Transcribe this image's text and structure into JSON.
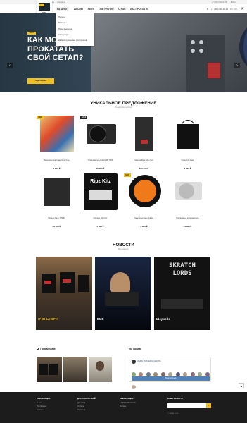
{
  "topbar": {
    "left": [
      "Оплата",
      "Доставка",
      "Контакты"
    ],
    "right": [
      "+7 (000) 000-00-00",
      "Войти"
    ]
  },
  "header": {
    "logo_text": "KAI",
    "nav": [
      "КАТАЛОГ",
      "ШКОЛЫ",
      "RENT",
      "ПОРТФОЛИО",
      "О НАС",
      "КАК ПРОЕХАТЬ"
    ],
    "search_icon": "search-icon",
    "phone": "+7 (000) 000-00-00",
    "langs": "RU / EN",
    "cart_icon": "cart-icon"
  },
  "dropdown": {
    "items": [
      "Пульты",
      "Миксеры",
      "Проигрыватели",
      "Аксессуары",
      "Кабели и разъёмы для пультов"
    ]
  },
  "hero": {
    "badge": "RENT",
    "title": "КАК МОЖНО ПРОКАТАТЬ СВОЙ СЕТАП?",
    "button": "ПОДРОБНЕЕ",
    "prev": "‹",
    "next": "›"
  },
  "products_section": {
    "title": "УНИКАЛЬНОЕ ПРЕДЛОЖЕНИЕ",
    "subtitle": "Посмотреть каталог",
    "items": [
      {
        "name": "Виниловая пластинка Ninja Tune",
        "price": "3 800 ₽",
        "badge": "NEW"
      },
      {
        "name": "Проигрыватель Reloop RP-7000",
        "price": "42 000 ₽",
        "badge": "SALE"
      },
      {
        "name": "Микшер Rane Sixty-Two",
        "price": "120 000 ₽",
        "badge": ""
      },
      {
        "name": "Сумка KAI black",
        "price": "1 990 ₽",
        "badge": ""
      },
      {
        "name": "Микшер Rane TTM 57",
        "price": "38 000 ₽",
        "badge": ""
      },
      {
        "name": "Слипмат Ripz Kitz",
        "price": "1 500 ₽",
        "badge": ""
      },
      {
        "name": "Часы виниловые Orange",
        "price": "3 800 ₽",
        "badge": "NEW"
      },
      {
        "name": "Портативный проигрыватель",
        "price": "14 490 ₽",
        "badge": ""
      }
    ]
  },
  "news_section": {
    "title": "НОВОСТИ",
    "subtitle": "Все новости",
    "items": [
      "ОЧЕНЬ НЕРЧ",
      "DMC",
      "Шоу кейс"
    ]
  },
  "social": {
    "instagram_title": "/ onkaimaster",
    "vk_title": "/ onkai",
    "vk_group": "ONKAI MASTER DJ ШКОЛА",
    "vk_button": "Подписаться"
  },
  "footer": {
    "col1": {
      "title": "ИНФОРМАЦИЯ",
      "items": [
        "О нас",
        "Портфолио",
        "Контакты"
      ]
    },
    "col2": {
      "title": "ДЛЯ ПОКУПАТЕЛЕЙ",
      "items": [
        "Доставка",
        "Оплата",
        "Гарантия"
      ]
    },
    "col3": {
      "title": "ИНФОРМАЦИЯ",
      "items": [
        "+7 (000) 000-00-00",
        "Москва"
      ]
    },
    "col4": {
      "title": "НАШИ НОВОСТИ"
    },
    "copy": "© ONKAI, 2019"
  },
  "side_button": "▲"
}
